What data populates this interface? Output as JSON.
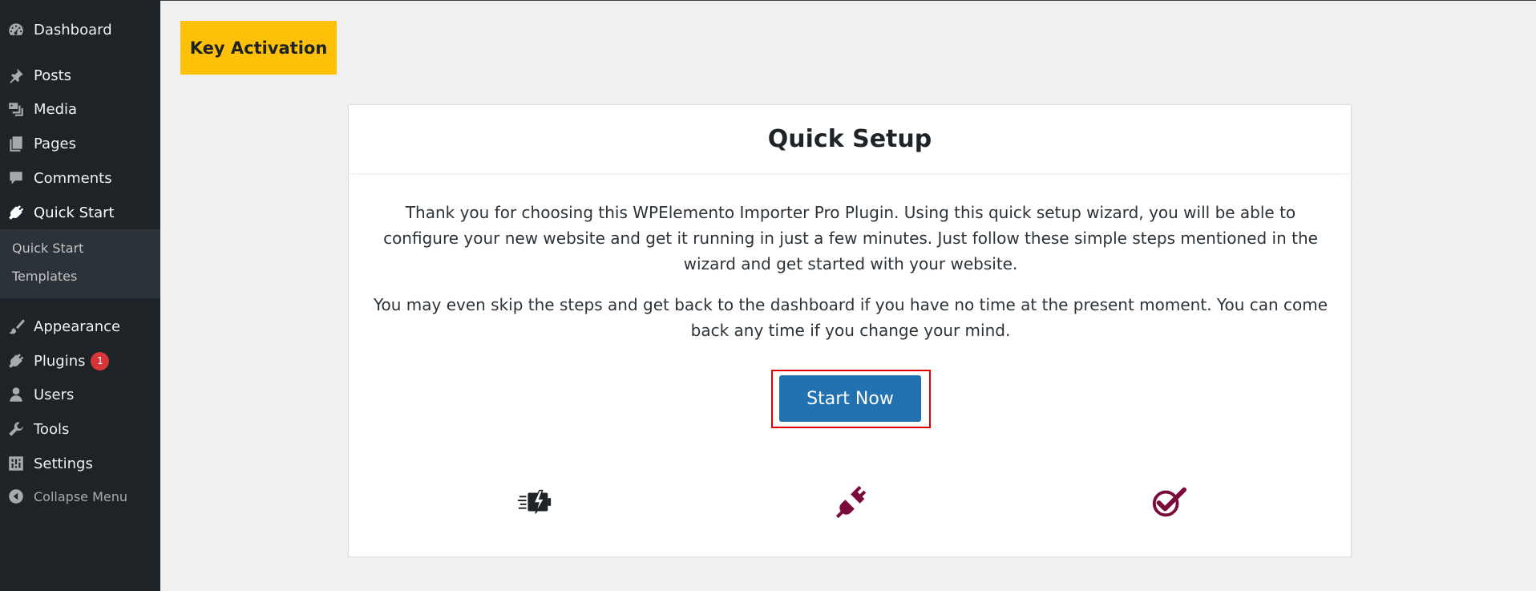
{
  "sidebar": {
    "items": [
      {
        "label": "Dashboard",
        "icon": "dashboard-icon"
      },
      {
        "label": "Posts",
        "icon": "pin-icon"
      },
      {
        "label": "Media",
        "icon": "media-icon"
      },
      {
        "label": "Pages",
        "icon": "pages-icon"
      },
      {
        "label": "Comments",
        "icon": "comment-icon"
      },
      {
        "label": "Quick Start",
        "icon": "plug-icon"
      },
      {
        "label": "Appearance",
        "icon": "brush-icon"
      },
      {
        "label": "Plugins",
        "icon": "plugin-icon",
        "badge": "1"
      },
      {
        "label": "Users",
        "icon": "user-icon"
      },
      {
        "label": "Tools",
        "icon": "wrench-icon"
      },
      {
        "label": "Settings",
        "icon": "settings-icon"
      }
    ],
    "submenu": [
      {
        "label": "Quick Start"
      },
      {
        "label": "Templates"
      }
    ],
    "collapse_label": "Collapse Menu"
  },
  "key_activation_label": "Key Activation",
  "card": {
    "title": "Quick Setup",
    "paragraph1": "Thank you for choosing this WPElemento Importer Pro Plugin. Using this quick setup wizard, you will be able to configure your new website and get it running in just a few minutes. Just follow these simple steps mentioned in the wizard and get started with your website.",
    "paragraph2": "You may even skip the steps and get back to the dashboard if you have no time at the present moment. You can come back any time if you change your mind.",
    "start_button": "Start Now",
    "feature_icons": [
      "fast-charge-icon",
      "plug-connect-icon",
      "checkmark-circle-icon"
    ]
  },
  "colors": {
    "sidebar_bg": "#1d2327",
    "accent_yellow": "#ffc107",
    "primary_blue": "#2271b1",
    "icon_maroon": "#7a0a3a",
    "highlight_red": "#e00000"
  }
}
